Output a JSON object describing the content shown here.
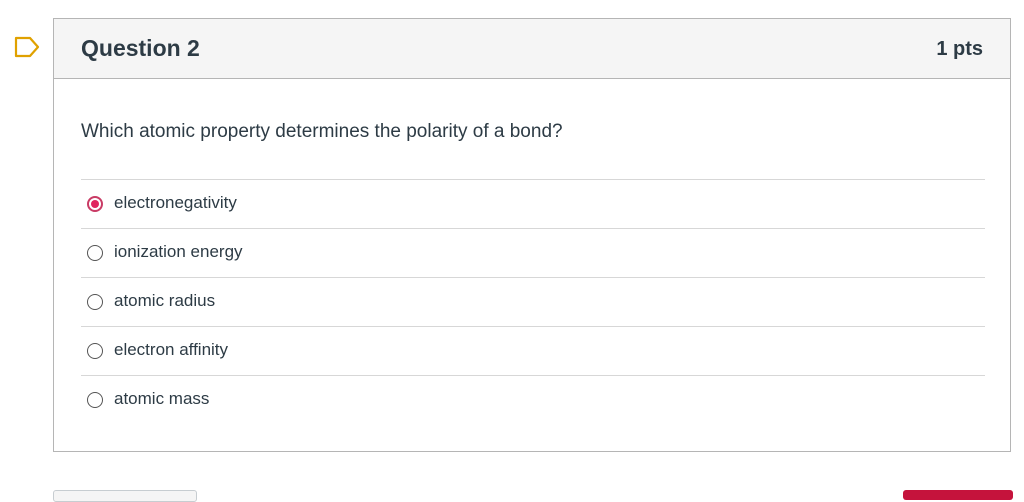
{
  "question": {
    "title": "Question 2",
    "points": "1 pts",
    "text": "Which atomic property determines the polarity of a bond?",
    "answers": [
      {
        "label": "electronegativity",
        "selected": true
      },
      {
        "label": "ionization energy",
        "selected": false
      },
      {
        "label": "atomic radius",
        "selected": false
      },
      {
        "label": "electron affinity",
        "selected": false
      },
      {
        "label": "atomic mass",
        "selected": false
      }
    ]
  },
  "icons": {
    "flag": "flag-question-icon"
  },
  "colors": {
    "accent": "#e0245e",
    "flag": "#e0a100",
    "header_bg": "#f5f5f5",
    "text": "#2d3b45",
    "border": "#b5b5b5"
  }
}
